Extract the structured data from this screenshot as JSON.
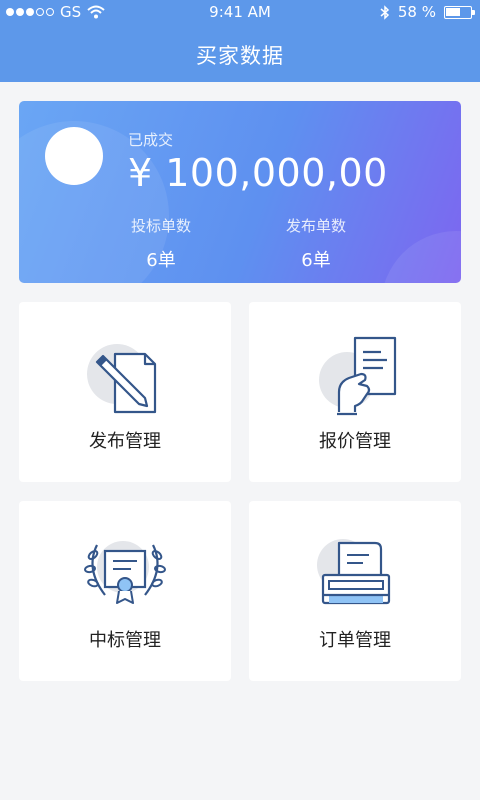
{
  "status_bar": {
    "carrier": "GS",
    "time": "9:41 AM",
    "battery": "58 %",
    "battery_level": 0.58
  },
  "header": {
    "title": "买家数据"
  },
  "summary": {
    "deal_label": "已成交",
    "deal_amount": "¥ 100,000,00",
    "stats": [
      {
        "label": "投标单数",
        "value": "6单"
      },
      {
        "label": "发布单数",
        "value": "6单"
      }
    ]
  },
  "menu": {
    "items": [
      {
        "label": "发布管理",
        "icon": "pen-document-icon"
      },
      {
        "label": "报价管理",
        "icon": "hand-document-icon"
      },
      {
        "label": "中标管理",
        "icon": "award-certificate-icon"
      },
      {
        "label": "订单管理",
        "icon": "printer-icon"
      }
    ]
  },
  "colors": {
    "header": "#5d98ea",
    "card_gradient_start": "#6aa6f4",
    "card_gradient_end": "#7d66f0",
    "icon_stroke": "#34568a",
    "icon_circle": "#e4e6ea",
    "icon_accent": "#8fc3f5"
  }
}
